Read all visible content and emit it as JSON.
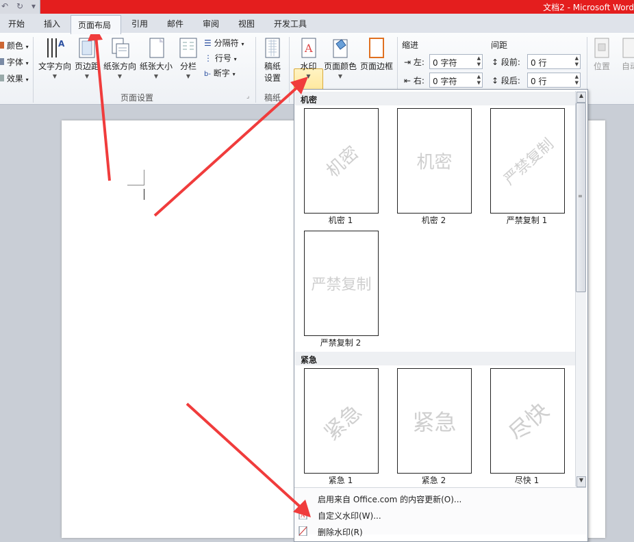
{
  "window": {
    "title": "文档2  -  Microsoft Word"
  },
  "tabs": [
    {
      "label": "开始"
    },
    {
      "label": "插入"
    },
    {
      "label": "页面布局",
      "active": true
    },
    {
      "label": "引用"
    },
    {
      "label": "邮件"
    },
    {
      "label": "审阅"
    },
    {
      "label": "视图"
    },
    {
      "label": "开发工具"
    }
  ],
  "ribbon": {
    "theme": {
      "colors_label": "颜色",
      "fonts_label": "字体",
      "effects_label": "效果"
    },
    "page_setup": {
      "group_label": "页面设置",
      "text_direction": "文字方向",
      "margins": "页边距",
      "orientation": "纸张方向",
      "size": "纸张大小",
      "columns": "分栏",
      "breaks": "分隔符",
      "line_numbers": "行号",
      "hyphenation": "断字"
    },
    "manuscript": {
      "group_label": "稿纸",
      "settings_line1": "稿纸",
      "settings_line2": "设置"
    },
    "background": {
      "watermark": "水印",
      "page_color": "页面颜色",
      "page_borders": "页面边框"
    },
    "indent": {
      "title": "缩进",
      "left_label": "左:",
      "left_value": "0 字符",
      "right_label": "右:",
      "right_value": "0 字符"
    },
    "spacing": {
      "title": "间距",
      "before_label": "段前:",
      "before_value": "0 行",
      "after_label": "段后:",
      "after_value": "0 行"
    },
    "arrange": {
      "position": "位置",
      "auto_wrap": "自动"
    }
  },
  "gallery": {
    "sections": [
      {
        "title": "机密",
        "items": [
          {
            "label": "机密 1",
            "text": "机密",
            "style": "diagonal"
          },
          {
            "label": "机密 2",
            "text": "机密",
            "style": "horizontal"
          },
          {
            "label": "严禁复制 1",
            "text": "严禁复制",
            "style": "diagonal"
          },
          {
            "label": "严禁复制 2",
            "text": "严禁复制",
            "style": "horizontal"
          }
        ]
      },
      {
        "title": "紧急",
        "items": [
          {
            "label": "紧急 1",
            "text": "紧急",
            "style": "diagonal"
          },
          {
            "label": "紧急 2",
            "text": "紧急",
            "style": "horizontal"
          },
          {
            "label": "尽快 1",
            "text": "尽快",
            "style": "diagonal"
          }
        ]
      }
    ],
    "menu": [
      {
        "label": "启用来自 Office.com 的内容更新(O)..."
      },
      {
        "label": "自定义水印(W)..."
      },
      {
        "label": "删除水印(R)"
      }
    ]
  },
  "colors": {
    "title_bar": "#e41e1e",
    "annotation_arrow": "#f03c3c",
    "watermark_button": "#ffd968"
  }
}
